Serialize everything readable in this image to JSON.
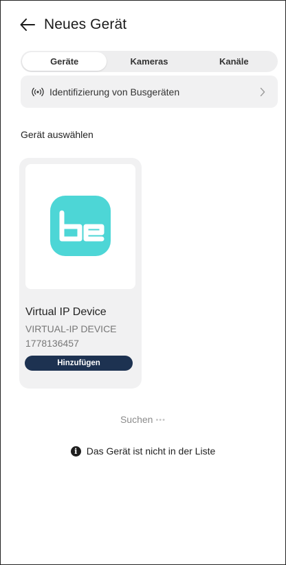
{
  "header": {
    "title": "Neues Gerät",
    "back_icon": "arrow-left-icon"
  },
  "tabs": [
    {
      "label": "Geräte",
      "active": true
    },
    {
      "label": "Kameras",
      "active": false
    },
    {
      "label": "Kanäle",
      "active": false
    }
  ],
  "bus_identification": {
    "label": "Identifizierung von Busgeräten"
  },
  "section_title": "Gerät auswählen",
  "device": {
    "logo_text": "be",
    "logo_color": "#4dd6d6",
    "name": "Virtual IP Device",
    "type": "VIRTUAL-IP DEVICE",
    "serial": "1778136457",
    "add_label": "Hinzufügen"
  },
  "search": {
    "label": "Suchen",
    "dots": "•••"
  },
  "not_listed": {
    "label": "Das Gerät ist nicht in der Liste",
    "icon_glyph": "i"
  },
  "colors": {
    "primary_button": "#1d3251",
    "card_bg": "#f1f1f2"
  }
}
